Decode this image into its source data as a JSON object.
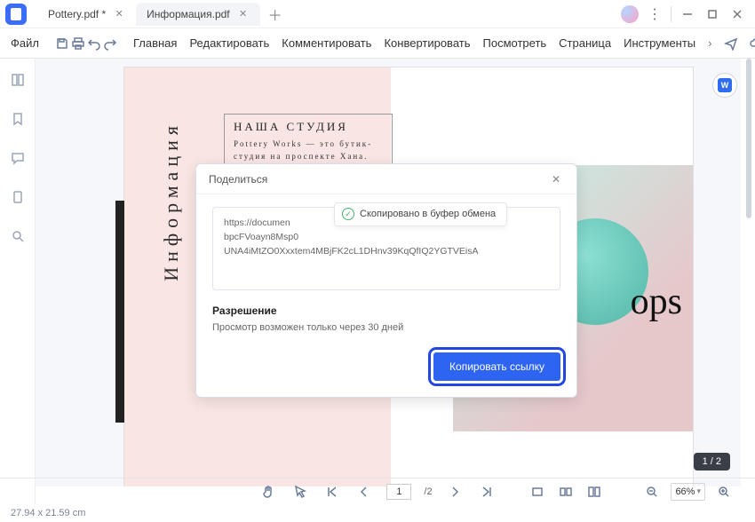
{
  "titlebar": {
    "tabs": [
      {
        "label": "Pottery.pdf *"
      },
      {
        "label": "Информация.pdf"
      }
    ]
  },
  "menubar": {
    "file": "Файл",
    "items": [
      "Главная",
      "Редактировать",
      "Комментировать",
      "Конвертировать",
      "Посмотреть",
      "Страница",
      "Инструменты"
    ]
  },
  "document": {
    "vert_title": "Информация",
    "studio_title": "НАША СТУДИЯ",
    "studio_desc": "Pottery Works — это бутик-студия на проспекте Хана. Светлая, с достаточны",
    "ops": "ops",
    "page_badge": "1 / 2"
  },
  "dialog": {
    "title": "Поделиться",
    "link": "https://documen\nbpcFVoayn8Msp0\nUNA4iMtZO0Xxxtem4MBjFK2cL1DHnv39KqQfIQ2YGTVEisA",
    "toast": "Скопировано в буфер обмена",
    "perm_title": "Разрешение",
    "perm_desc": "Просмотр возможен только через 30 дней",
    "copy_btn": "Копировать ссылку"
  },
  "bottombar": {
    "page_current": "1",
    "page_total": "/2",
    "zoom": "66%"
  },
  "status": {
    "dimensions": "27.94 x 21.59 cm"
  }
}
